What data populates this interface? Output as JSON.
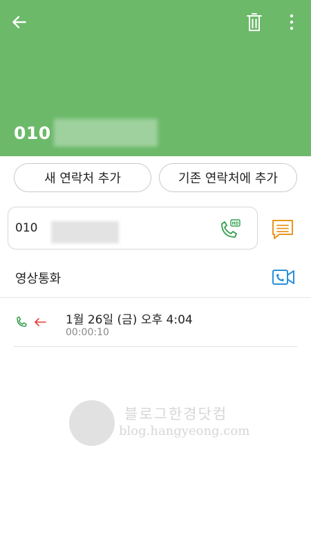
{
  "header": {
    "phone_prefix": "010",
    "back_icon": "arrow-left-icon",
    "delete_icon": "trash-icon",
    "more_icon": "more-vertical-icon",
    "background": "#6cb96a"
  },
  "actions": {
    "new_contact_label": "새 연락처 추가",
    "existing_contact_label": "기존 연락처에 추가"
  },
  "number_card": {
    "number_prefix": "010",
    "call_icon": "hd-call-icon",
    "message_icon": "message-icon"
  },
  "video_call": {
    "label": "영상통화",
    "icon": "video-call-icon"
  },
  "call_log": [
    {
      "date": "1월 26일 (금) 오후 4:04",
      "duration": "00:00:10",
      "type_icon": "phone-icon",
      "direction_icon": "incoming-arrow-icon"
    }
  ],
  "watermark": {
    "title": "블로그한경닷컴",
    "url": "blog.hangyeong.com"
  },
  "colors": {
    "accent_green": "#2e9e4a",
    "message_orange": "#e8951d",
    "video_blue": "#2a8fd8",
    "incoming_red": "#e53935"
  }
}
